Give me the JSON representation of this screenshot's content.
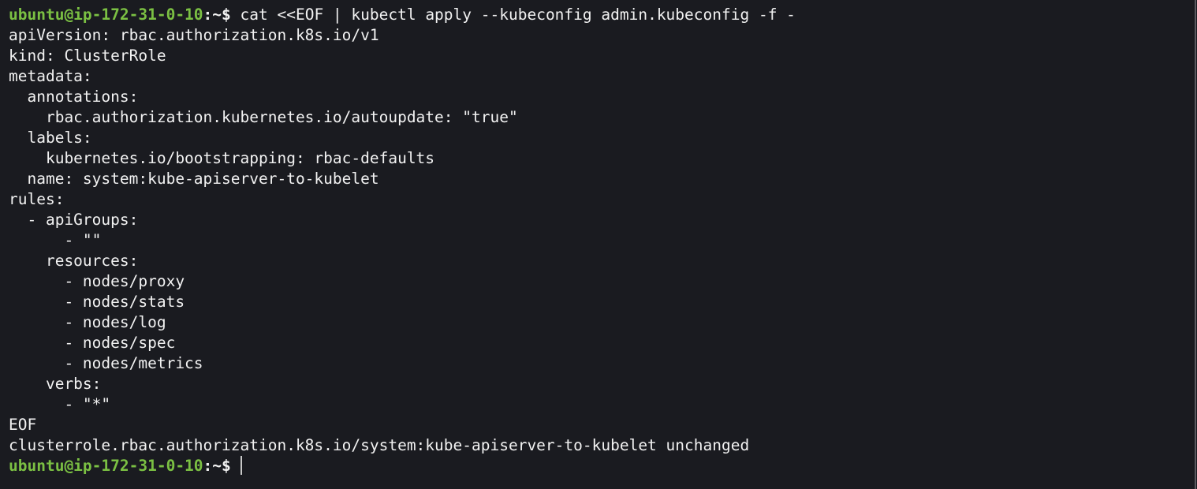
{
  "prompt": {
    "user_host": "ubuntu@ip-172-31-0-10",
    "separator": ":",
    "path_symbol": "~$"
  },
  "command": " cat <<EOF | kubectl apply --kubeconfig admin.kubeconfig -f -",
  "lines": [
    "apiVersion: rbac.authorization.k8s.io/v1",
    "kind: ClusterRole",
    "metadata:",
    "  annotations:",
    "    rbac.authorization.kubernetes.io/autoupdate: \"true\"",
    "  labels:",
    "    kubernetes.io/bootstrapping: rbac-defaults",
    "  name: system:kube-apiserver-to-kubelet",
    "rules:",
    "  - apiGroups:",
    "      - \"\"",
    "    resources:",
    "      - nodes/proxy",
    "      - nodes/stats",
    "      - nodes/log",
    "      - nodes/spec",
    "      - nodes/metrics",
    "    verbs:",
    "      - \"*\"",
    "EOF",
    "clusterrole.rbac.authorization.k8s.io/system:kube-apiserver-to-kubelet unchanged"
  ],
  "colors": {
    "background": "#1a1b20",
    "prompt_green": "#7bc043",
    "text": "#f2f2f2"
  }
}
